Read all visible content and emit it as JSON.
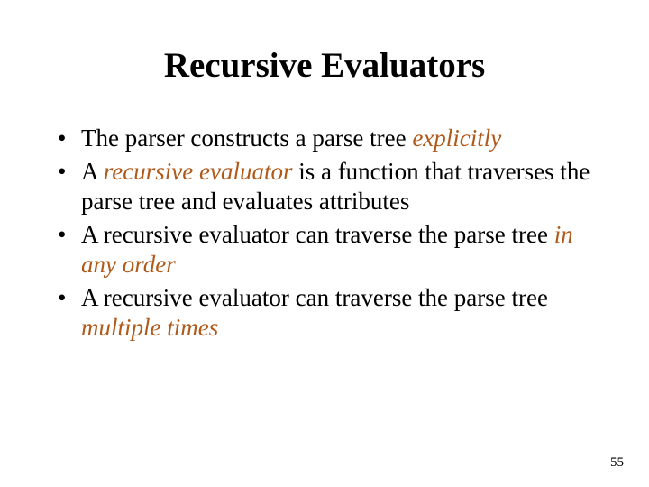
{
  "title": "Recursive Evaluators",
  "bullets": [
    {
      "pre": "The parser constructs a parse tree ",
      "accent": "explicitly",
      "post": ""
    },
    {
      "pre": "A ",
      "accent": "recursive evaluator",
      "post": " is a function that traverses the parse tree and evaluates attributes"
    },
    {
      "pre": "A recursive evaluator can traverse the parse tree ",
      "accent": "in any order",
      "post": ""
    },
    {
      "pre": "A recursive evaluator can traverse the parse tree ",
      "accent": "multiple times",
      "post": ""
    }
  ],
  "page_number": "55"
}
